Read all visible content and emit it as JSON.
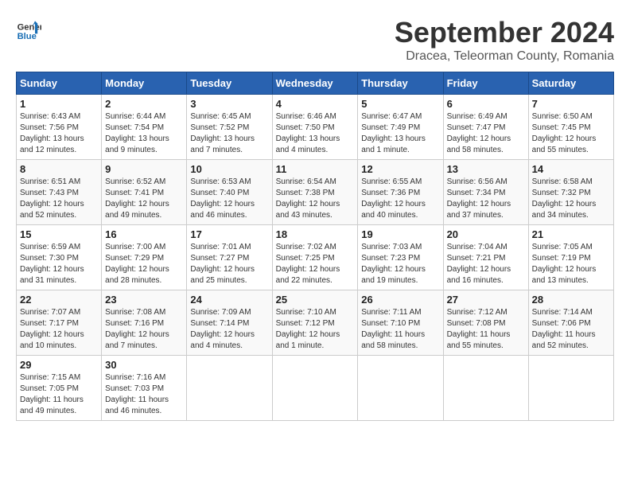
{
  "logo": {
    "line1": "General",
    "line2": "Blue"
  },
  "title": "September 2024",
  "subtitle": "Dracea, Teleorman County, Romania",
  "weekdays": [
    "Sunday",
    "Monday",
    "Tuesday",
    "Wednesday",
    "Thursday",
    "Friday",
    "Saturday"
  ],
  "weeks": [
    [
      {
        "day": "1",
        "info": "Sunrise: 6:43 AM\nSunset: 7:56 PM\nDaylight: 13 hours and 12 minutes."
      },
      {
        "day": "2",
        "info": "Sunrise: 6:44 AM\nSunset: 7:54 PM\nDaylight: 13 hours and 9 minutes."
      },
      {
        "day": "3",
        "info": "Sunrise: 6:45 AM\nSunset: 7:52 PM\nDaylight: 13 hours and 7 minutes."
      },
      {
        "day": "4",
        "info": "Sunrise: 6:46 AM\nSunset: 7:50 PM\nDaylight: 13 hours and 4 minutes."
      },
      {
        "day": "5",
        "info": "Sunrise: 6:47 AM\nSunset: 7:49 PM\nDaylight: 13 hours and 1 minute."
      },
      {
        "day": "6",
        "info": "Sunrise: 6:49 AM\nSunset: 7:47 PM\nDaylight: 12 hours and 58 minutes."
      },
      {
        "day": "7",
        "info": "Sunrise: 6:50 AM\nSunset: 7:45 PM\nDaylight: 12 hours and 55 minutes."
      }
    ],
    [
      {
        "day": "8",
        "info": "Sunrise: 6:51 AM\nSunset: 7:43 PM\nDaylight: 12 hours and 52 minutes."
      },
      {
        "day": "9",
        "info": "Sunrise: 6:52 AM\nSunset: 7:41 PM\nDaylight: 12 hours and 49 minutes."
      },
      {
        "day": "10",
        "info": "Sunrise: 6:53 AM\nSunset: 7:40 PM\nDaylight: 12 hours and 46 minutes."
      },
      {
        "day": "11",
        "info": "Sunrise: 6:54 AM\nSunset: 7:38 PM\nDaylight: 12 hours and 43 minutes."
      },
      {
        "day": "12",
        "info": "Sunrise: 6:55 AM\nSunset: 7:36 PM\nDaylight: 12 hours and 40 minutes."
      },
      {
        "day": "13",
        "info": "Sunrise: 6:56 AM\nSunset: 7:34 PM\nDaylight: 12 hours and 37 minutes."
      },
      {
        "day": "14",
        "info": "Sunrise: 6:58 AM\nSunset: 7:32 PM\nDaylight: 12 hours and 34 minutes."
      }
    ],
    [
      {
        "day": "15",
        "info": "Sunrise: 6:59 AM\nSunset: 7:30 PM\nDaylight: 12 hours and 31 minutes."
      },
      {
        "day": "16",
        "info": "Sunrise: 7:00 AM\nSunset: 7:29 PM\nDaylight: 12 hours and 28 minutes."
      },
      {
        "day": "17",
        "info": "Sunrise: 7:01 AM\nSunset: 7:27 PM\nDaylight: 12 hours and 25 minutes."
      },
      {
        "day": "18",
        "info": "Sunrise: 7:02 AM\nSunset: 7:25 PM\nDaylight: 12 hours and 22 minutes."
      },
      {
        "day": "19",
        "info": "Sunrise: 7:03 AM\nSunset: 7:23 PM\nDaylight: 12 hours and 19 minutes."
      },
      {
        "day": "20",
        "info": "Sunrise: 7:04 AM\nSunset: 7:21 PM\nDaylight: 12 hours and 16 minutes."
      },
      {
        "day": "21",
        "info": "Sunrise: 7:05 AM\nSunset: 7:19 PM\nDaylight: 12 hours and 13 minutes."
      }
    ],
    [
      {
        "day": "22",
        "info": "Sunrise: 7:07 AM\nSunset: 7:17 PM\nDaylight: 12 hours and 10 minutes."
      },
      {
        "day": "23",
        "info": "Sunrise: 7:08 AM\nSunset: 7:16 PM\nDaylight: 12 hours and 7 minutes."
      },
      {
        "day": "24",
        "info": "Sunrise: 7:09 AM\nSunset: 7:14 PM\nDaylight: 12 hours and 4 minutes."
      },
      {
        "day": "25",
        "info": "Sunrise: 7:10 AM\nSunset: 7:12 PM\nDaylight: 12 hours and 1 minute."
      },
      {
        "day": "26",
        "info": "Sunrise: 7:11 AM\nSunset: 7:10 PM\nDaylight: 11 hours and 58 minutes."
      },
      {
        "day": "27",
        "info": "Sunrise: 7:12 AM\nSunset: 7:08 PM\nDaylight: 11 hours and 55 minutes."
      },
      {
        "day": "28",
        "info": "Sunrise: 7:14 AM\nSunset: 7:06 PM\nDaylight: 11 hours and 52 minutes."
      }
    ],
    [
      {
        "day": "29",
        "info": "Sunrise: 7:15 AM\nSunset: 7:05 PM\nDaylight: 11 hours and 49 minutes."
      },
      {
        "day": "30",
        "info": "Sunrise: 7:16 AM\nSunset: 7:03 PM\nDaylight: 11 hours and 46 minutes."
      },
      null,
      null,
      null,
      null,
      null
    ]
  ]
}
